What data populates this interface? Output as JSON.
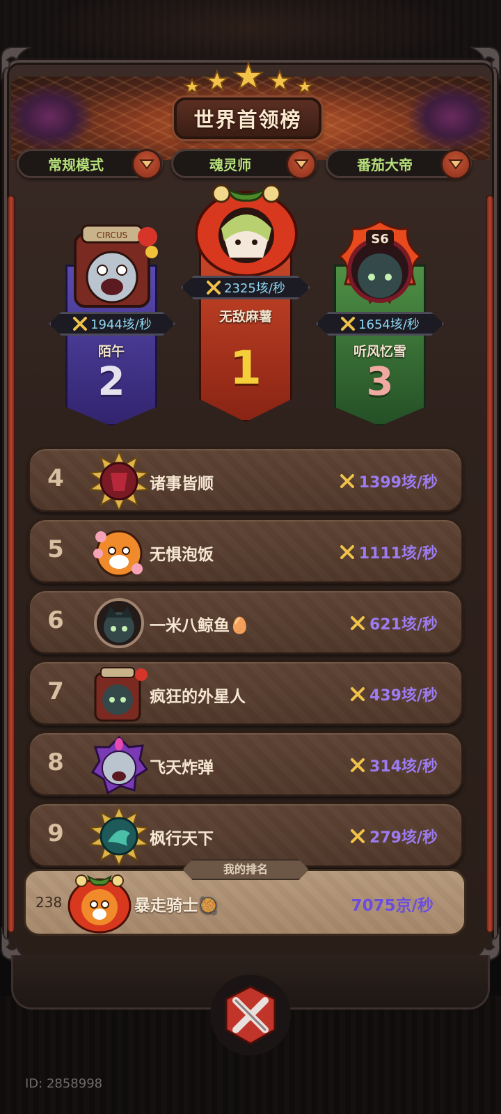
{
  "header": {
    "title": "世界首领榜"
  },
  "filters": [
    {
      "label": "常规模式"
    },
    {
      "label": "魂灵师"
    },
    {
      "label": "番茄大帝"
    }
  ],
  "podium": {
    "first": {
      "rank": "1",
      "name": "无敌麻薯",
      "score": "2325垓/秒"
    },
    "second": {
      "rank": "2",
      "name": "陌午",
      "score": "1944垓/秒",
      "badge": "CIRCUS"
    },
    "third": {
      "rank": "3",
      "name": "听风忆雪",
      "score": "1654垓/秒",
      "badge": "S6"
    }
  },
  "rankings": [
    {
      "rank": "4",
      "name": "诸事皆顺",
      "score": "1399垓/秒"
    },
    {
      "rank": "5",
      "name": "无惧泡饭",
      "score": "1111垓/秒"
    },
    {
      "rank": "6",
      "name": "一米八鲸鱼🥚",
      "score": "621垓/秒"
    },
    {
      "rank": "7",
      "name": "疯狂的外星人",
      "score": "439垓/秒"
    },
    {
      "rank": "8",
      "name": "飞天炸弹",
      "score": "314垓/秒"
    },
    {
      "rank": "9",
      "name": "枫行天下",
      "score": "279垓/秒"
    }
  ],
  "my_rank": {
    "label": "我的排名",
    "rank": "238",
    "name": "暴走骑士🥘",
    "score": "7075京/秒"
  },
  "footer": {
    "id_text": "ID: 2858998"
  },
  "colors": {
    "score_purple": "#9d7cf2",
    "filter_green": "#b6e07a",
    "first_banner": "#b63a22",
    "second_banner": "#3e2e82",
    "third_banner": "#2f6a34"
  }
}
